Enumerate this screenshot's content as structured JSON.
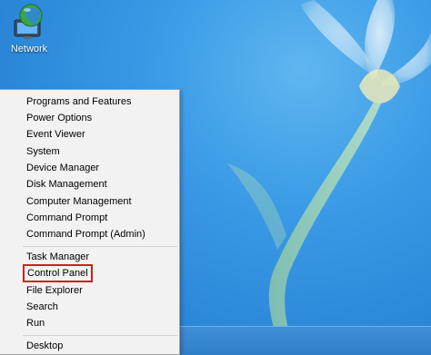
{
  "desktop": {
    "icons": [
      {
        "label": "Network",
        "icon": "network-globe-icon"
      }
    ]
  },
  "context_menu": {
    "items": [
      {
        "label": "Programs and Features"
      },
      {
        "label": "Power Options"
      },
      {
        "label": "Event Viewer"
      },
      {
        "label": "System"
      },
      {
        "label": "Device Manager"
      },
      {
        "label": "Disk Management"
      },
      {
        "label": "Computer Management"
      },
      {
        "label": "Command Prompt"
      },
      {
        "label": "Command Prompt (Admin)"
      },
      {
        "label": "Task Manager"
      },
      {
        "label": "Control Panel",
        "highlighted": true
      },
      {
        "label": "File Explorer"
      },
      {
        "label": "Search"
      },
      {
        "label": "Run"
      },
      {
        "label": "Desktop"
      }
    ]
  },
  "colors": {
    "highlight_border": "#c9231a",
    "desktop_accent": "#2b86d8",
    "menu_background": "#f2f2f2"
  }
}
